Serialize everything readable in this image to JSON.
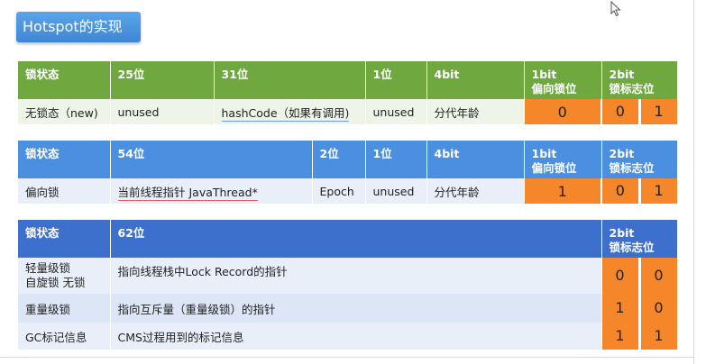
{
  "title": "Hotspot的实现",
  "table1": {
    "headers": [
      "锁状态",
      "25位",
      "31位",
      "1位",
      "4bit",
      "1bit\n偏向锁位",
      "2bit\n锁标志位"
    ],
    "row": [
      "无锁态（new)",
      "unused",
      "hashCode（如果有调用)",
      "unused",
      "分代年龄",
      "0",
      "0",
      "1"
    ]
  },
  "table2": {
    "headers": [
      "锁状态",
      "54位",
      "2位",
      "1位",
      "4bit",
      "1bit\n偏向锁位",
      "2bit\n锁标志位"
    ],
    "row": [
      "偏向锁",
      "当前线程指针 JavaThread*",
      "Epoch",
      "unused",
      "分代年龄",
      "1",
      "0",
      "1"
    ]
  },
  "table3": {
    "headers": [
      "锁状态",
      "62位",
      "2bit\n锁标志位"
    ],
    "rows": [
      {
        "label": "轻量级锁\n自旋锁 无锁",
        "desc": "指向线程栈中Lock Record的指针",
        "b1": "0",
        "b2": "0"
      },
      {
        "label": "重量级锁",
        "desc": "指向互斥量（重量级锁）的指针",
        "b1": "1",
        "b2": "0"
      },
      {
        "label": "GC标记信息",
        "desc": "CMS过程用到的标记信息",
        "b1": "1",
        "b2": "1"
      }
    ]
  }
}
